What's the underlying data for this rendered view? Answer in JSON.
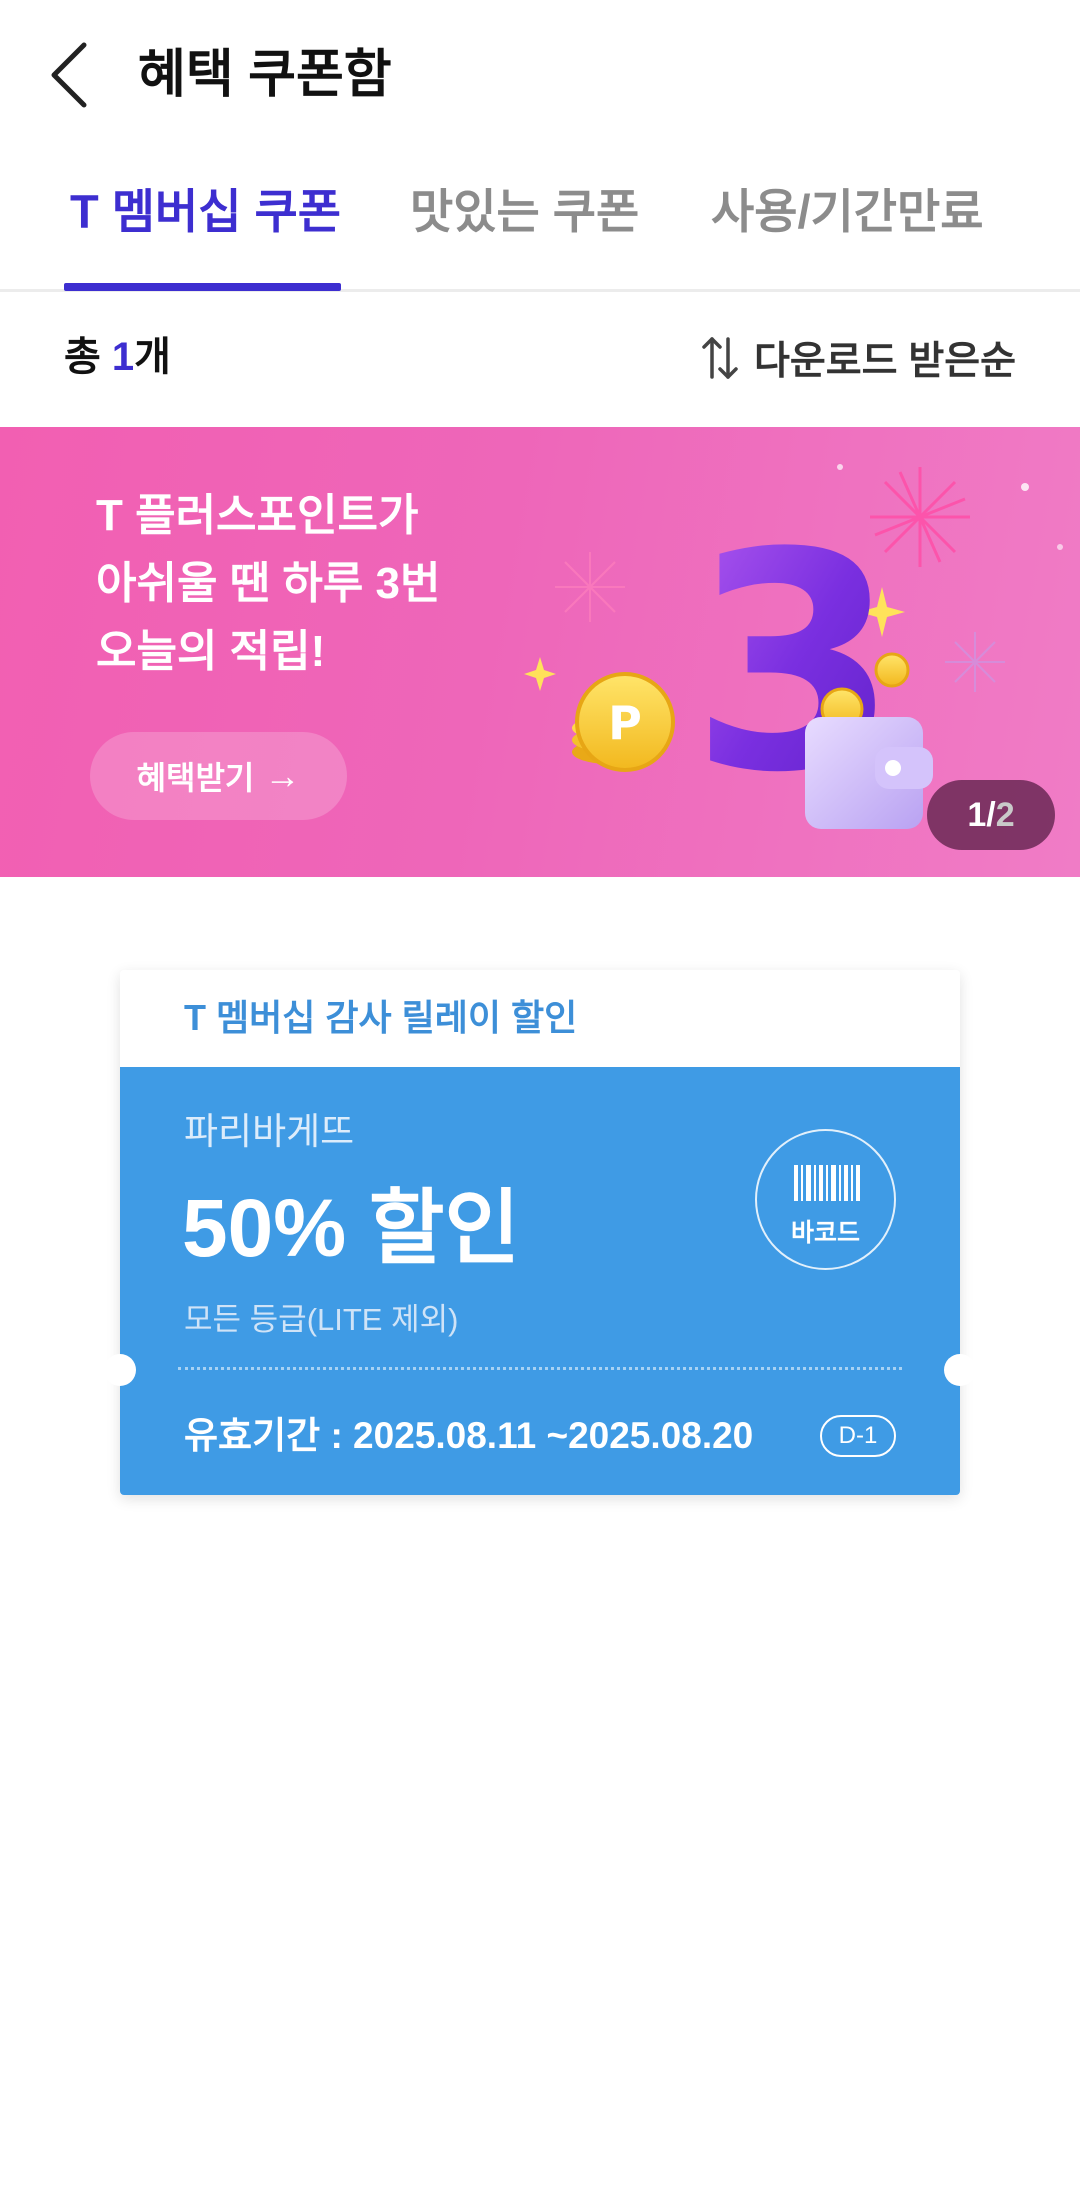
{
  "header": {
    "title": "혜택 쿠폰함",
    "back_icon": "chevron-left-icon"
  },
  "tabs": [
    {
      "label": "T 멤버십 쿠폰",
      "active": true
    },
    {
      "label": "맛있는 쿠폰",
      "active": false
    },
    {
      "label": "사용/기간만료",
      "active": false
    }
  ],
  "count": {
    "prefix": "총 ",
    "number": "1",
    "suffix": "개"
  },
  "sort": {
    "label": "다운로드 받은순",
    "icon": "sort-arrows-icon"
  },
  "banner": {
    "lines": [
      "T 플러스포인트가",
      "아쉬울 땐 하루 3번",
      "오늘의 적립!"
    ],
    "button_label": "혜택받기",
    "button_arrow": "→",
    "illustration_number": "3",
    "coin_letter": "P",
    "page_current": "1",
    "page_separator": "/",
    "page_total": "2"
  },
  "coupon": {
    "event_title": "T 멤버십 감사 릴레이 할인",
    "brand": "파리바게뜨",
    "discount": "50% 할인",
    "grade": "모든 등급(LITE 제외)",
    "barcode_label": "바코드",
    "validity": "유효기간 : 2025.08.11 ~2025.08.20",
    "dday": "D-1"
  },
  "colors": {
    "accent": "#3d2ed0",
    "coupon_blue": "#3f9be5",
    "banner_pink": "#f065b8"
  }
}
